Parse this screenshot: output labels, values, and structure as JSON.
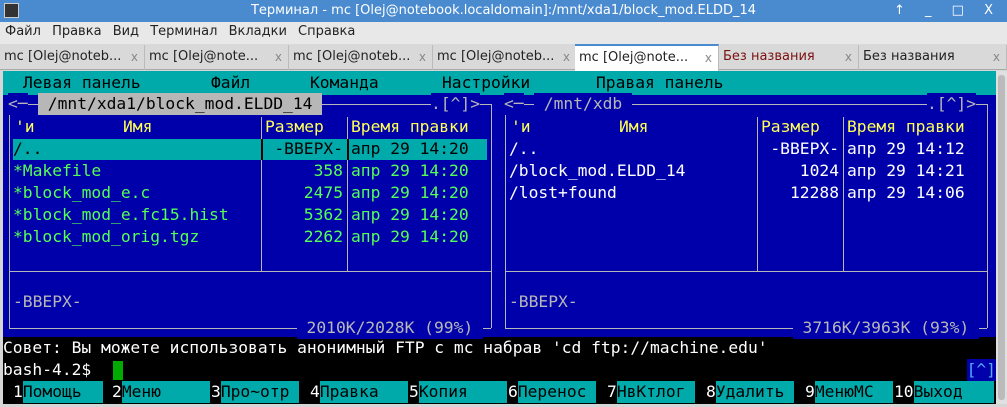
{
  "window": {
    "title": "Терминал - mc [Olej@notebook.localdomain]:/mnt/xda1/block_mod.ELDD_14",
    "controls": "↑ _ □ X"
  },
  "menubar": [
    "Файл",
    "Правка",
    "Вид",
    "Терминал",
    "Вкладки",
    "Справка"
  ],
  "tabs": [
    {
      "label": "mc [Olej@noteb...",
      "active": false
    },
    {
      "label": "mc [Olej@note...",
      "active": false
    },
    {
      "label": "mc [Olej@noteb...",
      "active": false
    },
    {
      "label": "mc [Olej@noteb...",
      "active": false
    },
    {
      "label": "mc [Olej@note...",
      "active": true
    },
    {
      "label": "Без названия",
      "active": false
    },
    {
      "label": "Без названия",
      "active": false
    }
  ],
  "tab_close": "x",
  "mc": {
    "menu": [
      "Левая панель",
      "Файл",
      "Команда",
      "Настройки",
      "Правая панель"
    ],
    "left": {
      "path": " /mnt/xda1/block_mod.ELDD_14 ",
      "corner_left": "<─",
      "corner_right": ".[^]>",
      "headers": {
        "sort": "'и",
        "name": "Имя",
        "size": "Размер",
        "time": "Время правки"
      },
      "rows": [
        {
          "name": "/..",
          "size": "-ВВЕРХ-",
          "time": "апр 29 14:20"
        },
        {
          "name": "*Makefile",
          "size": "358",
          "time": "апр 29 14:20"
        },
        {
          "name": "*block_mod_e.c",
          "size": "2475",
          "time": "апр 29 14:20"
        },
        {
          "name": "*block_mod_e.fc15.hist",
          "size": "5362",
          "time": "апр 29 14:20"
        },
        {
          "name": "*block_mod_orig.tgz",
          "size": "2262",
          "time": "апр 29 14:20"
        }
      ],
      "status": "-ВВЕРХ-",
      "disk": " 2010K/2028K (99%) "
    },
    "right": {
      "path": " /mnt/xdb ",
      "corner_left": "<─",
      "corner_right": ".[^]>",
      "headers": {
        "sort": "'и",
        "name": "Имя",
        "size": "Размер",
        "time": "Время правки"
      },
      "rows": [
        {
          "name": "/..",
          "size": "-ВВЕРХ-",
          "time": "апр 29 14:12"
        },
        {
          "name": "/block_mod.ELDD_14",
          "size": "1024",
          "time": "апр 29 14:21"
        },
        {
          "name": "/lost+found",
          "size": "12288",
          "time": "апр 29 14:06"
        }
      ],
      "status": "-ВВЕРХ-",
      "disk": " 3716K/3963K (93%) "
    },
    "hint": "Совет: Вы можете использовать анонимный FTP с mc набрав 'cd ftp://machine.edu'",
    "prompt": "bash-4.2$ ",
    "prompt_indicator": "[^]",
    "keybar": [
      {
        "n": "1",
        "l": "Помощь"
      },
      {
        "n": "2",
        "l": "Меню"
      },
      {
        "n": "3",
        "l": "Про~отр"
      },
      {
        "n": "4",
        "l": "Правка"
      },
      {
        "n": "5",
        "l": "Копия"
      },
      {
        "n": "6",
        "l": "Перенос"
      },
      {
        "n": "7",
        "l": "НвКтлог"
      },
      {
        "n": "8",
        "l": "Удалить"
      },
      {
        "n": "9",
        "l": "МенюMC"
      },
      {
        "n": "10",
        "l": "Выход"
      }
    ]
  },
  "colors": {
    "panel": "#0000aa",
    "cyan": "#00aaaa",
    "exec": "#55ff55",
    "header": "#ffff55",
    "cursor": "#00aa00"
  }
}
